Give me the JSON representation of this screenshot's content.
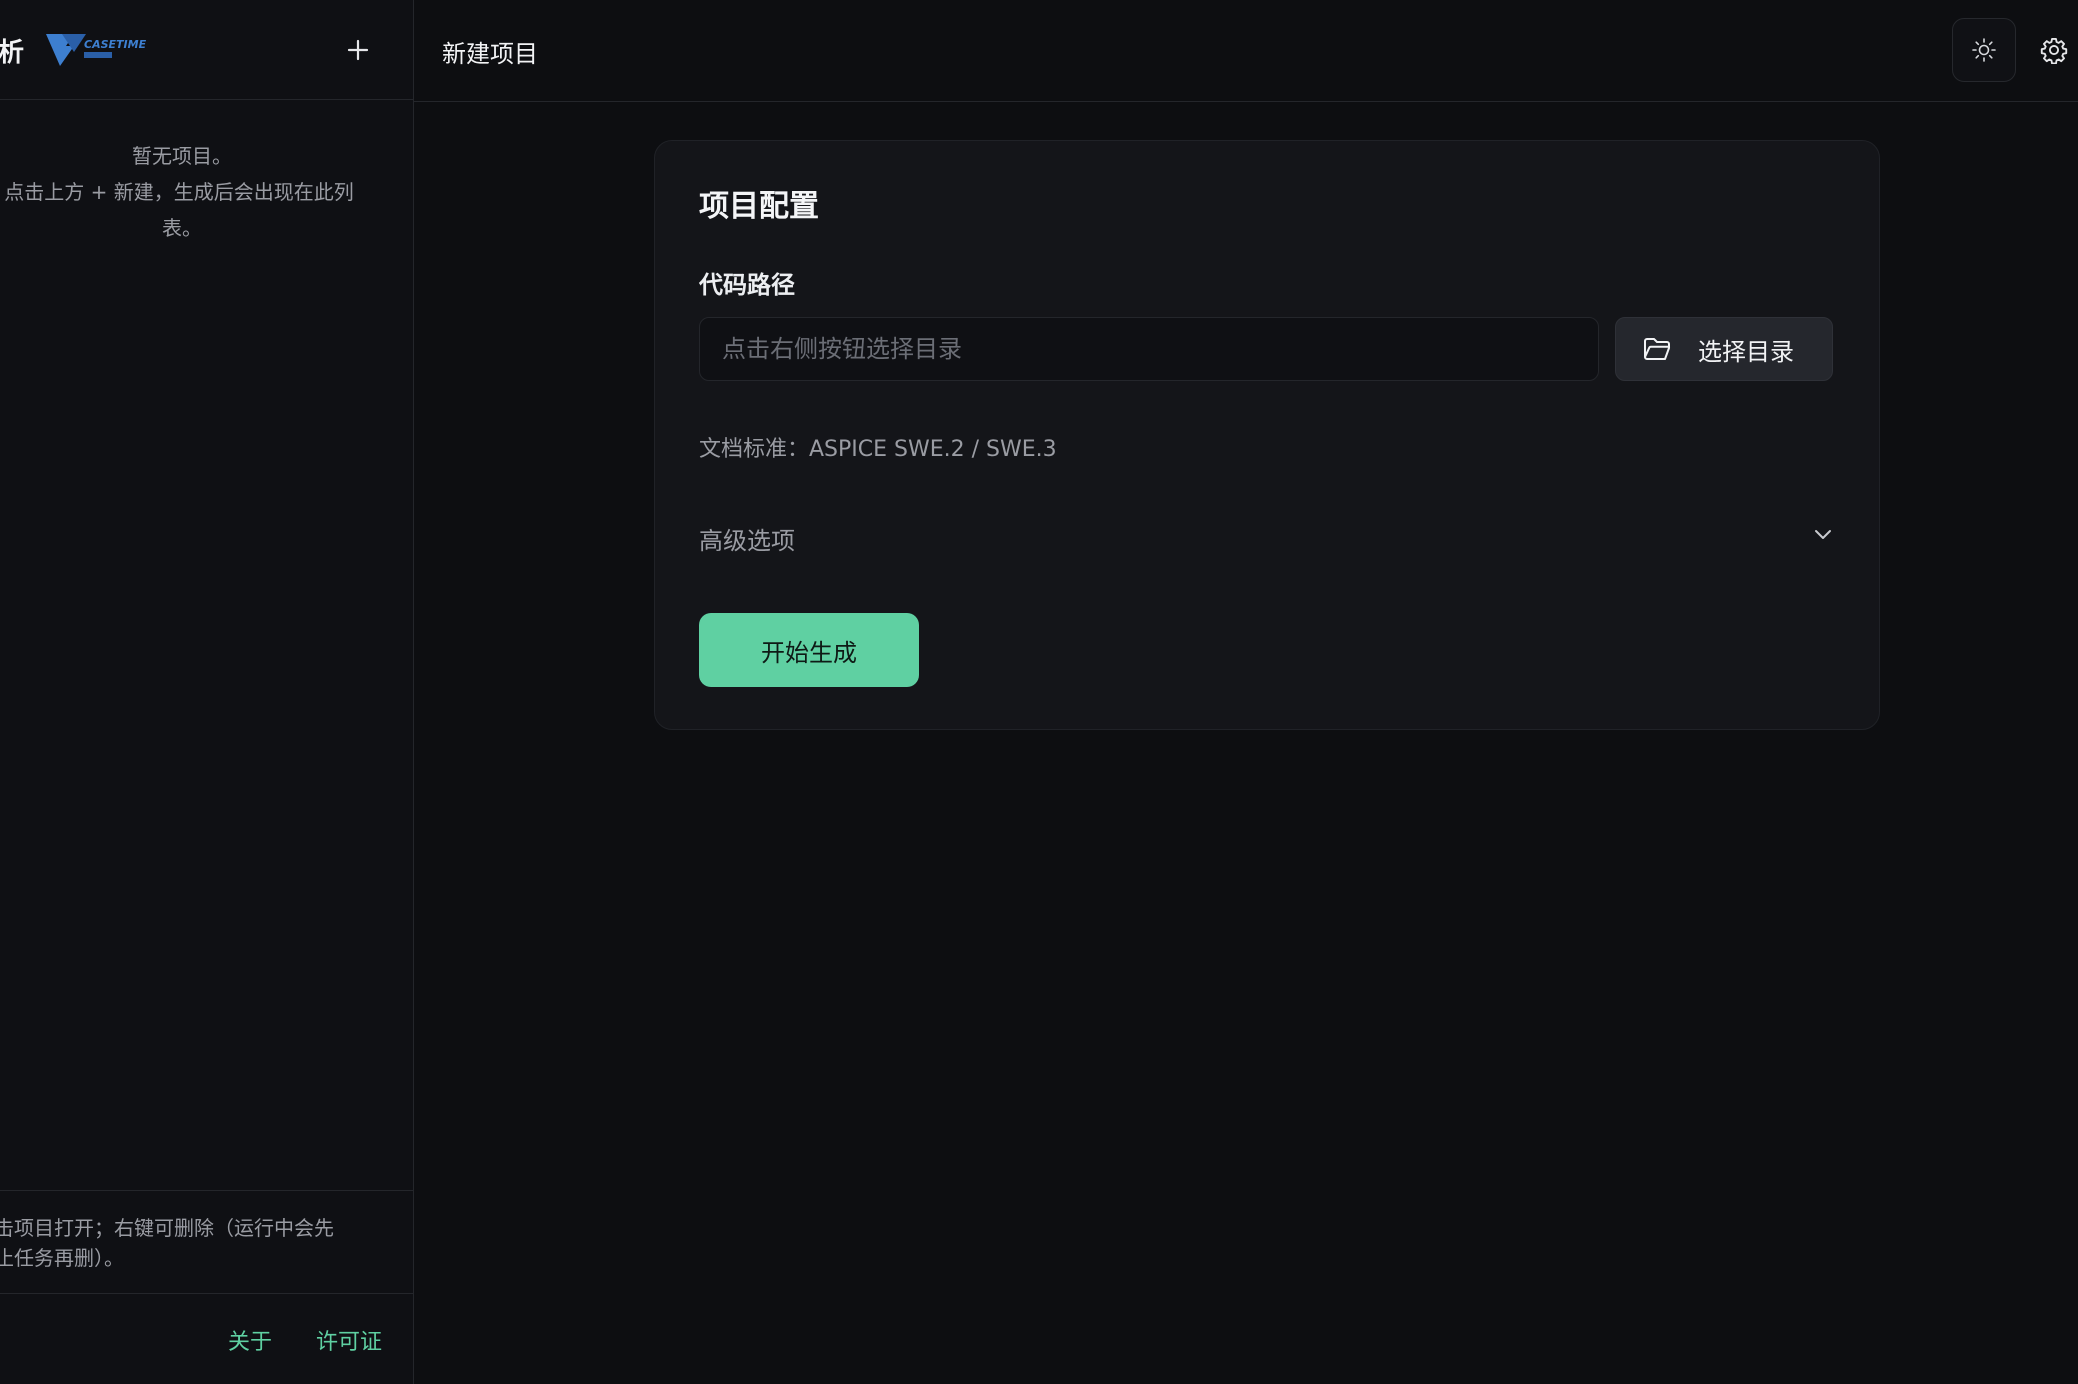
{
  "sidebar": {
    "brand_text": "析",
    "brand_logo_text": "CASETIME",
    "new_button_icon": "plus-icon",
    "empty_state": {
      "line1": "暂无项目。",
      "line2": "点击上方 + 新建，生成后会出现在此列",
      "line3": "表。"
    },
    "hint": {
      "line1": "击项目打开；右键可删除（运行中会先",
      "line2": "止任务再删）。"
    },
    "footer": {
      "about": "关于",
      "license": "许可证"
    }
  },
  "topbar": {
    "title": "新建项目",
    "theme_icon": "sun-icon",
    "settings_icon": "gear-icon"
  },
  "card": {
    "title": "项目配置",
    "code_path_label": "代码路径",
    "code_path_value": "",
    "code_path_placeholder": "点击右侧按钮选择目录",
    "choose_dir_label": "选择目录",
    "doc_standard": "文档标准：ASPICE SWE.2 / SWE.3",
    "advanced_label": "高级选项",
    "start_label": "开始生成"
  },
  "colors": {
    "accent": "#5fd0a2",
    "background": "#0d0e11",
    "card": "#141519"
  }
}
